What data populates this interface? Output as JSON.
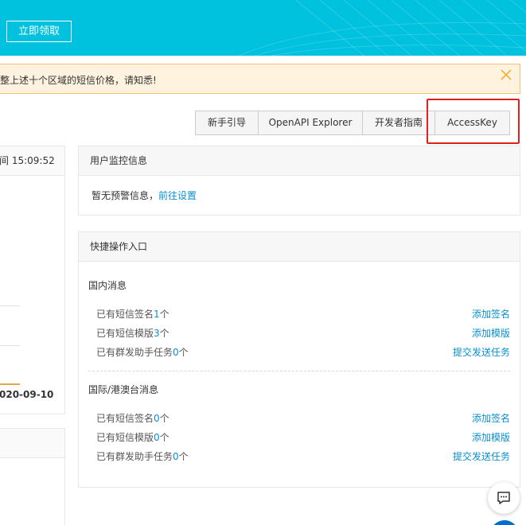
{
  "banner": {
    "button_label": "立即领取",
    "bg_color": "#00c1de"
  },
  "notice": {
    "text": "整上述十个区域的短信价格，请知悉!",
    "close_icon": "close-icon",
    "bg_color": "#fff3e0"
  },
  "toolbar": {
    "buttons": [
      {
        "label": "新手引导"
      },
      {
        "label": "OpenAPI Explorer"
      },
      {
        "label": "开发者指南"
      },
      {
        "label": "AccessKey"
      }
    ],
    "highlight_color": "#e0201b"
  },
  "left_panel": {
    "header_text": "间 15:09:52",
    "date_text": "020-09-10"
  },
  "monitor": {
    "title": "用户监控信息",
    "empty_text": "暂无预警信息，",
    "setup_link": "前往设置"
  },
  "quick": {
    "title": "快捷操作入口",
    "sections": [
      {
        "title": "国内消息",
        "rows": [
          {
            "prefix": "已有短信签名",
            "count": "1",
            "suffix": "个",
            "action": "添加签名"
          },
          {
            "prefix": "已有短信模版",
            "count": "3",
            "suffix": "个",
            "action": "添加模版"
          },
          {
            "prefix": "已有群发助手任务",
            "count": "0",
            "suffix": "个",
            "action": "提交发送任务"
          }
        ]
      },
      {
        "title": "国际/港澳台消息",
        "rows": [
          {
            "prefix": "已有短信签名",
            "count": "0",
            "suffix": "个",
            "action": "添加签名"
          },
          {
            "prefix": "已有短信模版",
            "count": "0",
            "suffix": "个",
            "action": "添加模版"
          },
          {
            "prefix": "已有群发助手任务",
            "count": "0",
            "suffix": "个",
            "action": "提交发送任务"
          }
        ]
      }
    ]
  },
  "floating": {
    "chat_icon": "chat-icon",
    "link_color": "#0a8fcf"
  }
}
